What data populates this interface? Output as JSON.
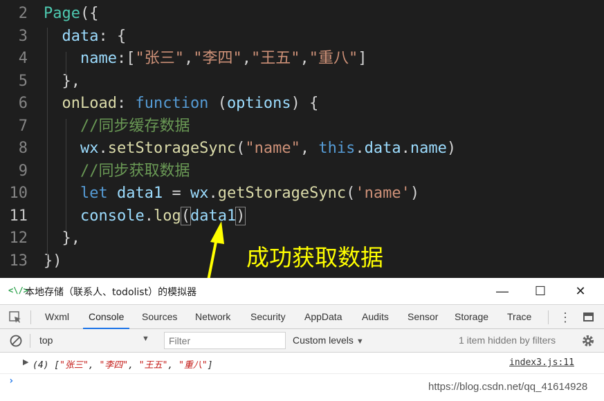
{
  "editor": {
    "lines": [
      {
        "n": "2",
        "html_parts": [
          [
            "t",
            "Page"
          ],
          [
            "",
            "({"
          ]
        ]
      },
      {
        "n": "3",
        "html_parts": [
          [
            "v",
            "  data"
          ],
          [
            "",
            ": {"
          ]
        ]
      },
      {
        "n": "4",
        "html_parts": [
          [
            "v",
            "    name"
          ],
          [
            "",
            ":["
          ],
          [
            "s",
            "\"张三\""
          ],
          [
            "",
            ","
          ],
          [
            "s",
            "\"李四\""
          ],
          [
            "",
            ","
          ],
          [
            "s",
            "\"王五\""
          ],
          [
            "",
            ","
          ],
          [
            "s",
            "\"重八\""
          ],
          [
            "",
            "]"
          ]
        ]
      },
      {
        "n": "5",
        "html_parts": [
          [
            "",
            "  },"
          ]
        ]
      },
      {
        "n": "6",
        "html_parts": [
          [
            "f",
            "  onLoad"
          ],
          [
            "",
            ": "
          ],
          [
            "k",
            "function"
          ],
          [
            "",
            " ("
          ],
          [
            "v",
            "options"
          ],
          [
            "",
            ") {"
          ]
        ]
      },
      {
        "n": "7",
        "html_parts": [
          [
            "c",
            "    //同步缓存数据"
          ]
        ]
      },
      {
        "n": "8",
        "html_parts": [
          [
            "v",
            "    wx"
          ],
          [
            "",
            "."
          ],
          [
            "f",
            "setStorageSync"
          ],
          [
            "",
            "("
          ],
          [
            "s",
            "\"name\""
          ],
          [
            "",
            ", "
          ],
          [
            "k",
            "this"
          ],
          [
            "",
            "."
          ],
          [
            "v",
            "data"
          ],
          [
            "",
            "."
          ],
          [
            "v",
            "name"
          ],
          [
            "",
            ")"
          ]
        ]
      },
      {
        "n": "9",
        "html_parts": [
          [
            "c",
            "    //同步获取数据"
          ]
        ]
      },
      {
        "n": "10",
        "html_parts": [
          [
            "k",
            "    let"
          ],
          [
            "",
            " "
          ],
          [
            "v",
            "data1"
          ],
          [
            "",
            " = "
          ],
          [
            "v",
            "wx"
          ],
          [
            "",
            "."
          ],
          [
            "f",
            "getStorageSync"
          ],
          [
            "",
            "("
          ],
          [
            "s",
            "'name'"
          ],
          [
            "",
            ")"
          ]
        ]
      },
      {
        "n": "11",
        "html_parts": [
          [
            "v",
            "    console"
          ],
          [
            "",
            "."
          ],
          [
            "f",
            "log"
          ],
          [
            "b",
            "("
          ],
          [
            "v",
            "data1"
          ],
          [
            "b",
            ")"
          ]
        ]
      },
      {
        "n": "12",
        "html_parts": [
          [
            "",
            "  },"
          ]
        ]
      },
      {
        "n": "13",
        "html_parts": [
          [
            "",
            "})"
          ]
        ]
      }
    ],
    "active_line": "11",
    "annotation": "成功获取数据"
  },
  "devtools": {
    "title": "本地存储（联系人、todolist）的模拟器",
    "title_icon": "<\\/>",
    "window_buttons": {
      "minimize": "—",
      "maximize": "☐",
      "close": "✕"
    },
    "tabs": [
      "Wxml",
      "Console",
      "Sources",
      "Network",
      "Security",
      "AppData",
      "Audits",
      "Sensor",
      "Storage",
      "Trace"
    ],
    "active_tab": "Console",
    "toolbar": {
      "context": "top",
      "filter_placeholder": "Filter",
      "levels": "Custom levels",
      "hidden_note": "1 item hidden by filters"
    },
    "log": {
      "prefix": "(4) [",
      "items": [
        "\"张三\"",
        "\"李四\"",
        "\"王五\"",
        "\"重八\""
      ],
      "suffix": "]",
      "source": "index3.js:11"
    },
    "watermark": "https://blog.csdn.net/qq_41614928"
  },
  "colors": {
    "editor_bg": "#1e1e1e",
    "keyword": "#569cd6",
    "string": "#ce9178",
    "comment": "#6a9955",
    "annotation": "#ffff00",
    "active_tab_underline": "#1a73e8"
  }
}
